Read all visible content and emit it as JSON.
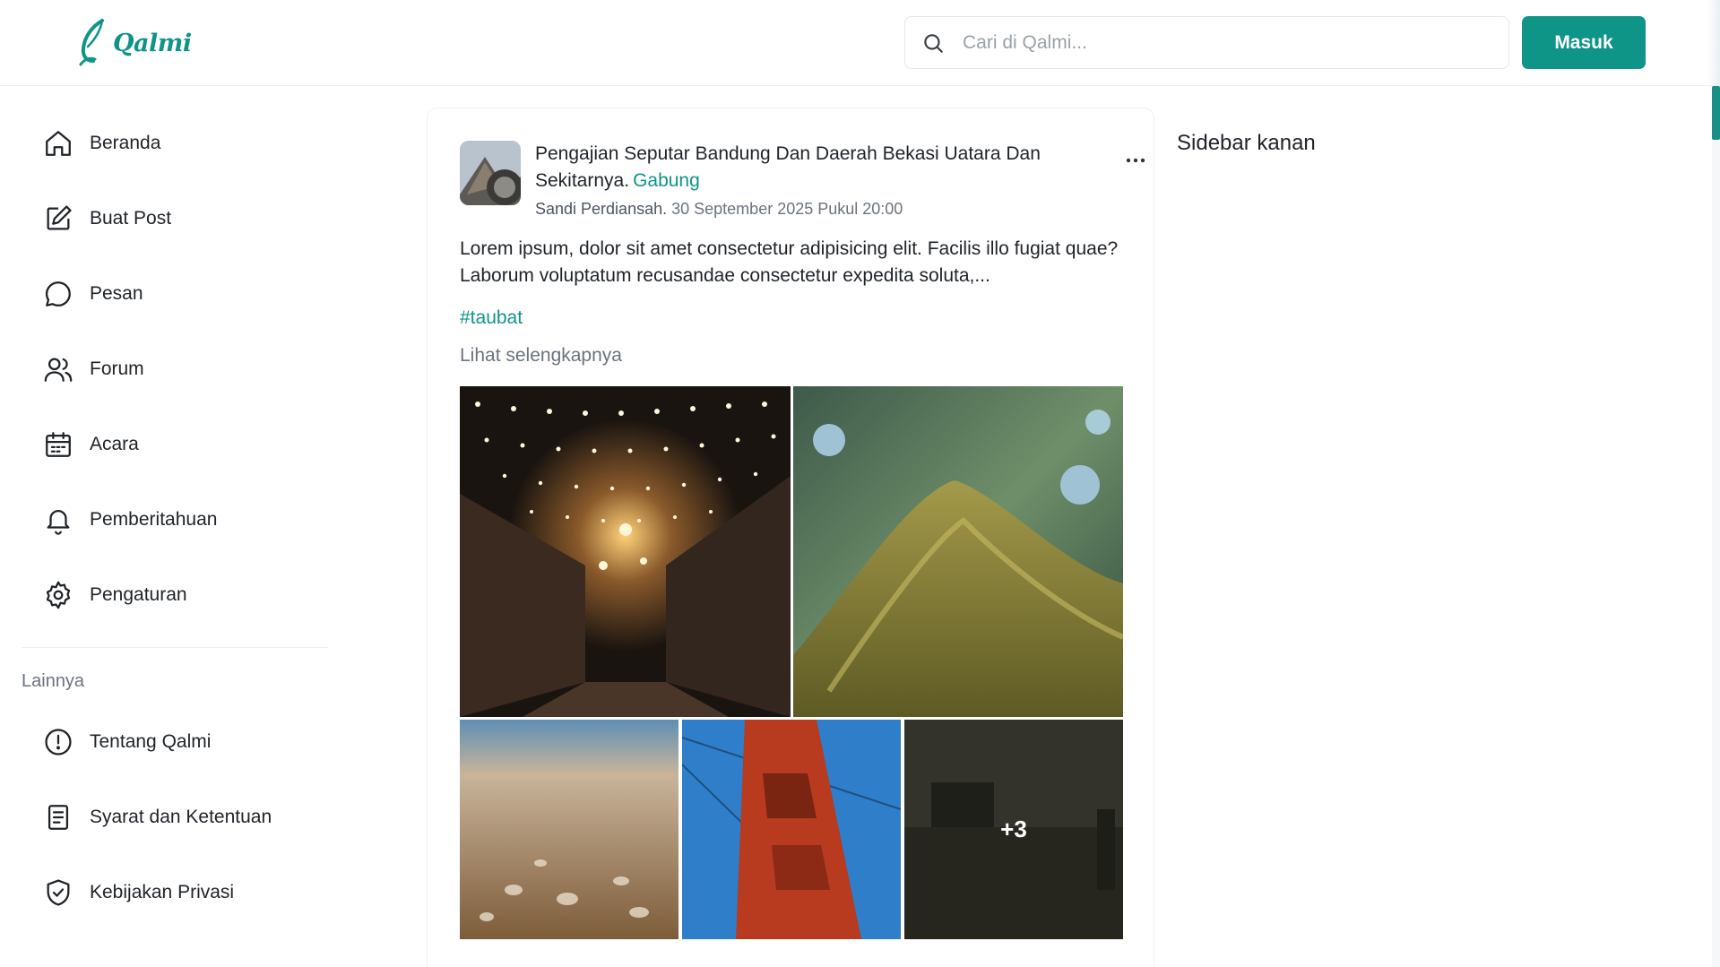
{
  "brand": {
    "name": "Qalmi",
    "accent": "#0f9488"
  },
  "header": {
    "search_placeholder": "Cari di Qalmi...",
    "login_label": "Masuk"
  },
  "nav": {
    "items": [
      {
        "label": "Beranda",
        "icon": "home-icon"
      },
      {
        "label": "Buat Post",
        "icon": "edit-icon"
      },
      {
        "label": "Pesan",
        "icon": "chat-icon"
      },
      {
        "label": "Forum",
        "icon": "users-icon"
      },
      {
        "label": "Acara",
        "icon": "calendar-icon"
      },
      {
        "label": "Pemberitahuan",
        "icon": "bell-icon"
      },
      {
        "label": "Pengaturan",
        "icon": "gear-icon"
      }
    ],
    "section_title": "Lainnya",
    "other_items": [
      {
        "label": "Tentang Qalmi",
        "icon": "info-icon"
      },
      {
        "label": "Syarat dan Ketentuan",
        "icon": "document-icon"
      },
      {
        "label": "Kebijakan Privasi",
        "icon": "shield-icon"
      }
    ]
  },
  "post": {
    "title": "Pengajian Seputar Bandung Dan Daerah Bekasi Uatara Dan Sekitarnya.",
    "join_label": "Gabung",
    "author": "Sandi Perdiansah.",
    "datetime": "30 September 2025 Pukul 20:00",
    "body": "Lorem ipsum, dolor sit amet consectetur adipisicing elit. Facilis illo fugiat quae? Laborum voluptatum recusandae consectetur expedita soluta,...",
    "hashtag": "#taubat",
    "see_more": "Lihat selengkapnya",
    "more_photos": "+3"
  },
  "right_sidebar": {
    "title": "Sidebar kanan"
  }
}
